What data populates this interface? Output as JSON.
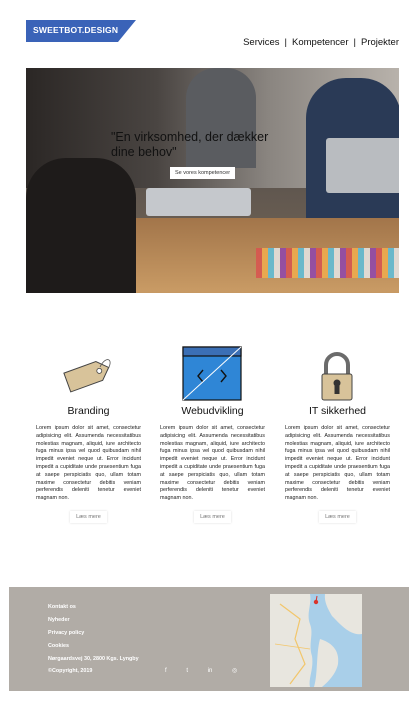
{
  "header": {
    "logo_text": "SWEETBOT.DESIGN",
    "logo_color": "#3a63b8",
    "nav": [
      "Services",
      "Kompetencer",
      "Projekter"
    ],
    "nav_separator": "|"
  },
  "hero": {
    "quote": "\"En virksomhed, der dækker dine behov\"",
    "button_label": "Se vores kompetencer"
  },
  "services": [
    {
      "icon": "price-tag-icon",
      "title": "Branding",
      "text": "Lorem ipsum dolor sit amet, consectetur adipisicing elit. Assumenda necessitatibus molestias magnam, aliquid, iure architecto fuga minus ipsa vel quod quibusdam nihil impedit eveniet neque ut. Error incidunt impedit a cupiditate unde praesentium fuga at saepe perspiciatis quo, ullam totam maxime consectetur debitis veniam perferendis deleniti tenetur eveniet magnam non.",
      "more": "Læs mere"
    },
    {
      "icon": "browser-window-icon",
      "title": "Webudvikling",
      "text": "Lorem ipsum dolor sit amet, consectetur adipisicing elit. Assumenda necessitatibus molestias magnam, aliquid, iure architecto fuga minus ipsa vel quod quibusdam nihil impedit eveniet neque ut. Error incidunt impedit a cupiditate unde praesentium fuga at saepe perspiciatis quo, ullam totam maxime consectetur debitis veniam perferendis deleniti tenetur eveniet magnam non.",
      "more": "Læs mere"
    },
    {
      "icon": "padlock-icon",
      "title": "IT sikkerhed",
      "text": "Lorem ipsum dolor sit amet, consectetur adipisicing elit. Assumenda necessitatibus molestias magnam, aliquid, iure architecto fuga minus ipsa vel quod quibusdam nihil impedit eveniet neque ut. Error incidunt impedit a cupiditate unde praesentium fuga at saepe perspiciatis quo, ullam totam maxime consectetur debitis veniam perferendis deleniti tenetur eveniet magnam non.",
      "more": "Læs mere"
    }
  ],
  "footer": {
    "links": [
      "Kontakt os",
      "Nyheder",
      "Privacy policy",
      "Cookies",
      "Nørgaardsvej 30, 2800 Kgs. Lyngby",
      "©Copyright, 2019"
    ],
    "social": [
      "f",
      "t",
      "in",
      "◎"
    ],
    "social_icons": [
      "facebook-icon",
      "twitter-icon",
      "linkedin-icon",
      "instagram-icon"
    ],
    "background": "#b1aca6"
  }
}
